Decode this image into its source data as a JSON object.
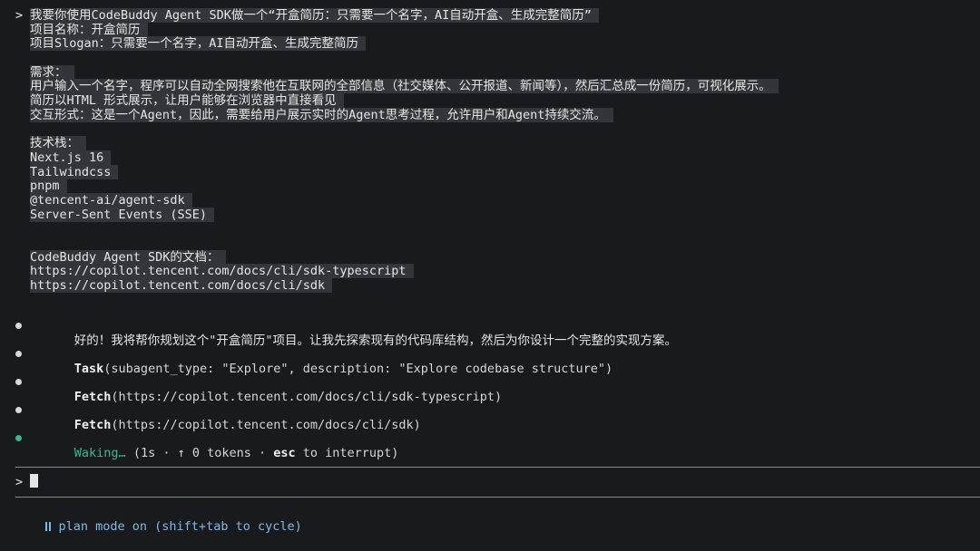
{
  "prompt": {
    "chevron": ">",
    "lines": [
      "我要你使用CodeBuddy Agent SDK做一个“开盒简历：只需要一个名字，AI自动开盒、生成完整简历”",
      "项目名称：开盒简历",
      "项目Slogan：只需要一个名字，AI自动开盒、生成完整简历",
      "",
      "需求：",
      "用户输入一个名字，程序可以自动全网搜索他在互联网的全部信息（社交媒体、公开报道、新闻等），然后汇总成一份简历，可视化展示。",
      "简历以HTML 形式展示，让用户能够在浏览器中直接看见",
      "交互形式：这是一个Agent，因此，需要给用户展示实时的Agent思考过程，允许用户和Agent持续交流。",
      "",
      "技术栈：",
      "Next.js 16",
      "Tailwindcss",
      "pnpm",
      "@tencent-ai/agent-sdk",
      "Server-Sent Events (SSE)",
      "",
      "",
      "CodeBuddy Agent SDK的文档：",
      "https://copilot.tencent.com/docs/cli/sdk-typescript",
      "https://copilot.tencent.com/docs/cli/sdk"
    ]
  },
  "messages": {
    "reply": "好的！我将帮你规划这个\"开盒简历\"项目。让我先探索现有的代码库结构，然后为你设计一个完整的实现方案。",
    "task_name": "Task",
    "task_args": "(subagent_type: \"Explore\", description: \"Explore codebase structure\")",
    "fetch1_name": "Fetch",
    "fetch1_args": "(https://copilot.tencent.com/docs/cli/sdk-typescript)",
    "fetch2_name": "Fetch",
    "fetch2_args": "(https://copilot.tencent.com/docs/cli/sdk)",
    "waking_label": "Waking…",
    "waking_detail_a": " (1s · ↑ 0 tokens · ",
    "waking_key": "esc",
    "waking_detail_b": " to interrupt)"
  },
  "input": {
    "chevron": ">"
  },
  "status": {
    "text": "plan mode on (shift+tab to cycle)"
  },
  "colors": {
    "background": "#191a1e",
    "accent_green": "#3fb68b",
    "status_blue": "#7fb9e6"
  }
}
